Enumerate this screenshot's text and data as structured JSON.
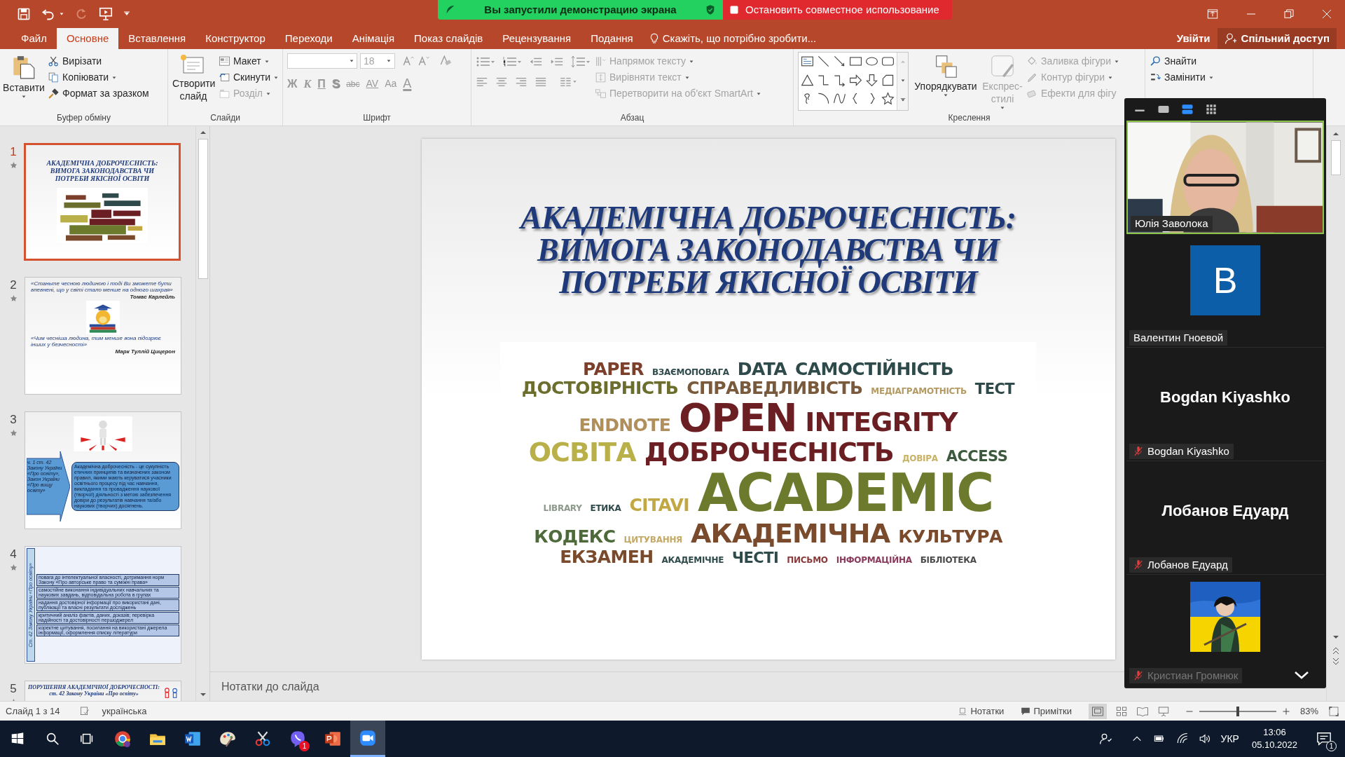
{
  "title_bar": {
    "share_banner": "Вы запустили демонстрацию экрана",
    "stop_share": "Остановить совместное использование"
  },
  "tabs": [
    {
      "label": "Файл",
      "selected": false
    },
    {
      "label": "Основне",
      "selected": true
    },
    {
      "label": "Вставлення",
      "selected": false
    },
    {
      "label": "Конструктор",
      "selected": false
    },
    {
      "label": "Переходи",
      "selected": false
    },
    {
      "label": "Анімація",
      "selected": false
    },
    {
      "label": "Показ слайдів",
      "selected": false
    },
    {
      "label": "Рецензування",
      "selected": false
    },
    {
      "label": "Подання",
      "selected": false
    }
  ],
  "tell_me": "Скажіть, що потрібно зробити...",
  "sign_in": "Увійти",
  "share": "Спільний доступ",
  "ribbon": {
    "clipboard": {
      "paste": "Вставити",
      "items": [
        "Вирізати",
        "Копіювати",
        "Формат за зразком"
      ],
      "label": "Буфер обміну"
    },
    "slides": {
      "new_slide": "Створити слайд",
      "items": [
        {
          "label": "Макет",
          "disabled": false
        },
        {
          "label": "Скинути",
          "disabled": false
        },
        {
          "label": "Розділ",
          "disabled": true
        }
      ],
      "label": "Слайди"
    },
    "font": {
      "size": "18",
      "format_buttons": [
        "Ж",
        "К",
        "П",
        "S",
        "abc",
        "AV",
        "Aa",
        "A"
      ],
      "label": "Шрифт"
    },
    "paragraph": {
      "items": [
        "Напрямок тексту",
        "Вирівняти текст",
        "Перетворити на об'єкт SmartArt"
      ],
      "label": "Абзац"
    },
    "drawing": {
      "buttons": [
        {
          "label": "Упорядкувати",
          "disabled": false
        },
        {
          "label": "Експрес-стилі",
          "disabled": true
        }
      ],
      "items": [
        "Заливка фігури",
        "Контур фігури",
        "Ефекти для фігу"
      ],
      "label": "Креслення"
    },
    "editing": {
      "items": [
        "Знайти",
        "Замінити"
      ]
    }
  },
  "thumbnails": [
    {
      "number": "1",
      "selected": true,
      "kind": "title",
      "title": "АКАДЕМІЧНА ДОБРОЧЕСНІСТЬ: ВИМОГА ЗАКОНОДАВСТВА ЧИ ПОТРЕБИ ЯКІСНОЇ ОСВІТИ"
    },
    {
      "number": "2",
      "selected": false,
      "kind": "quote",
      "quotes": [
        {
          "text": "«Станьте чесною людиною і тоді Ви зможете бути впевнені, що у світі стало менше на одного шахрая»",
          "author": "Томас Карлейль"
        },
        {
          "text": "«Чим чесніша людина, тим менше вона  підозрює інших у безчесності»",
          "author": "Марк Туллій Цицерон"
        }
      ]
    },
    {
      "number": "3",
      "selected": false,
      "kind": "definition",
      "arrow_text": "ч. 1 ст. 42 Закону України «Про освіту», Закон України «Про вищу освіту»",
      "box_text": "Академічна доброчесність - це сукупність етичних принципів та визначених законом правил, якими мають керуватися учасники освітнього процесу під час навчання, викладання та провадження наукової (творчої) діяльності з метою забезпечення довіри до результатів навчання та/або наукових (творчих) досягнень."
    },
    {
      "number": "4",
      "selected": false,
      "kind": "list",
      "side_label": "Ст. 42 Закону України «Про освіту»",
      "items": [
        "повага до інтелектуальної власності, дотримання норм Закону «Про авторське право та суміжні права»",
        "самостійне виконання індивідуальних навчальних та наукових завдань, відповідальна робота в групах",
        "надання достовірної інформації про використані дані, публікації та власні результати досліджень",
        "критичний аналіз фактів, даних, доказів; перевірка надійності та достовірності першоджерел",
        "коректне цитування, посилання на використані джерела інформації, оформлення списку літератури"
      ]
    },
    {
      "number": "5",
      "selected": false,
      "kind": "violation",
      "title": "ПОРУШЕННЯ АКАДЕМІЧНОЇ ДОБРОЧЕСНОСТІ:",
      "subtitle": "ст. 42 Закону України «Про освіту»"
    }
  ],
  "slide": {
    "title_lines": [
      "АКАДЕМІЧНА ДОБРОЧЕСНІСТЬ:",
      "ВИМОГА ЗАКОНОДАВСТВА ЧИ",
      "ПОТРЕБИ ЯКІСНОЇ ОСВІТИ"
    ],
    "word_cloud": [
      {
        "text": "PAPER",
        "color": "#7b3f2b",
        "kind": "m"
      },
      {
        "text": "ВЗАЄМОПОВАГА",
        "color": "#2f4a4a",
        "kind": "xs"
      },
      {
        "text": "DATA",
        "color": "#2f4a4a",
        "kind": "m"
      },
      {
        "text": "САМОСТІЙНІСТЬ",
        "color": "#2f4a4a",
        "kind": "m"
      },
      {
        "text": "ДОСТОВІРНІСТЬ",
        "color": "#6b6e2c",
        "kind": "m"
      },
      {
        "text": "СПРАВЕДЛИВІСТЬ",
        "color": "#7a5a3c",
        "kind": "m"
      },
      {
        "text": "МЕДІАГРАМОТНІСТЬ",
        "color": "#b39a62",
        "kind": "xs"
      },
      {
        "text": "ТЕСТ",
        "color": "#2f4a4a",
        "kind": "s"
      },
      {
        "text": "ENDNOTE",
        "color": "#b08f5a",
        "kind": "m"
      },
      {
        "text": "OPEN",
        "color": "#6b1f22",
        "kind": "xl"
      },
      {
        "text": "INTEGRITY",
        "color": "#6b1f22",
        "kind": "l"
      },
      {
        "text": "ОСВІТА",
        "color": "#b9b04a",
        "kind": "l"
      },
      {
        "text": "ДОБРОЧЕСНІСТЬ",
        "color": "#6b1f22",
        "kind": "l"
      },
      {
        "text": "ДОВІРА",
        "color": "#c9b264",
        "kind": "xs"
      },
      {
        "text": "ACCESS",
        "color": "#3d5a3e",
        "kind": "s"
      },
      {
        "text": "LIBRARY",
        "color": "#8d9a8c",
        "kind": "xs"
      },
      {
        "text": "ЕТИКА",
        "color": "#2f4a4a",
        "kind": "xs"
      },
      {
        "text": "CITAVI",
        "color": "#c2a844",
        "kind": "m"
      },
      {
        "text": "ACADEMIC",
        "color": "#6b7a2c",
        "kind": "xxl"
      },
      {
        "text": "КОДЕКС",
        "color": "#4f6a3a",
        "kind": "m"
      },
      {
        "text": "ЦИТУВАННЯ",
        "color": "#c4aa66",
        "kind": "xs"
      },
      {
        "text": "АКАДЕМІЧНА",
        "color": "#7a4a2c",
        "kind": "l"
      },
      {
        "text": "КУЛЬТУРА",
        "color": "#7a4a2c",
        "kind": "m"
      },
      {
        "text": "ЕКЗАМЕН",
        "color": "#7a4a2c",
        "kind": "m"
      },
      {
        "text": "АКАДЕМІЧНЕ",
        "color": "#2f4a4a",
        "kind": "xs"
      },
      {
        "text": "ЧЕСТІ",
        "color": "#2f4a4a",
        "kind": "s"
      },
      {
        "text": "ПИСЬМО",
        "color": "#8a3a3a",
        "kind": "xs"
      },
      {
        "text": "ІНФОРМАЦІЙНА",
        "color": "#8a3a5a",
        "kind": "xs"
      },
      {
        "text": "БІБЛІОТЕКА",
        "color": "#4a4a4a",
        "kind": "xs"
      }
    ]
  },
  "notes_placeholder": "Нотатки до слайда",
  "status_bar": {
    "slide_info": "Слайд 1 з 14",
    "language": "українська",
    "notes": "Нотатки",
    "comments": "Примітки",
    "zoom": "83%",
    "zoom_slider": {
      "level": 0.5
    }
  },
  "zoom_panel": {
    "view_buttons": [
      {
        "selected": false
      },
      {
        "selected": false
      },
      {
        "selected": true
      },
      {
        "selected": false
      }
    ],
    "tiles": [
      {
        "kind": "video",
        "name": "Юлія Заволока",
        "speaking": true,
        "muted": false
      },
      {
        "kind": "avatar",
        "initial": "B",
        "name": "Валентин Гноевой",
        "speaking": false,
        "muted": false
      },
      {
        "kind": "name",
        "display": "Bogdan Kiyashko",
        "name": "Bogdan Kiyashko",
        "speaking": false,
        "muted": true
      },
      {
        "kind": "name",
        "display": "Лобанов Едуард",
        "name": "Лобанов Едуард",
        "speaking": false,
        "muted": true
      },
      {
        "name": "Кристиан Громнюк",
        "speaking": false,
        "muted": true
      }
    ]
  },
  "taskbar": {
    "apps": [
      {
        "active": false
      },
      {
        "active": false
      },
      {
        "active": false
      },
      {
        "active": false
      },
      {
        "active": false
      },
      {
        "active": false
      },
      {
        "active": false
      },
      {
        "active": false
      },
      {
        "active": false,
        "badge": "1"
      },
      {
        "active": false
      },
      {
        "active": true
      }
    ],
    "language": "УКР",
    "time": "13:06",
    "date": "05.10.2022",
    "notifications": "1"
  }
}
